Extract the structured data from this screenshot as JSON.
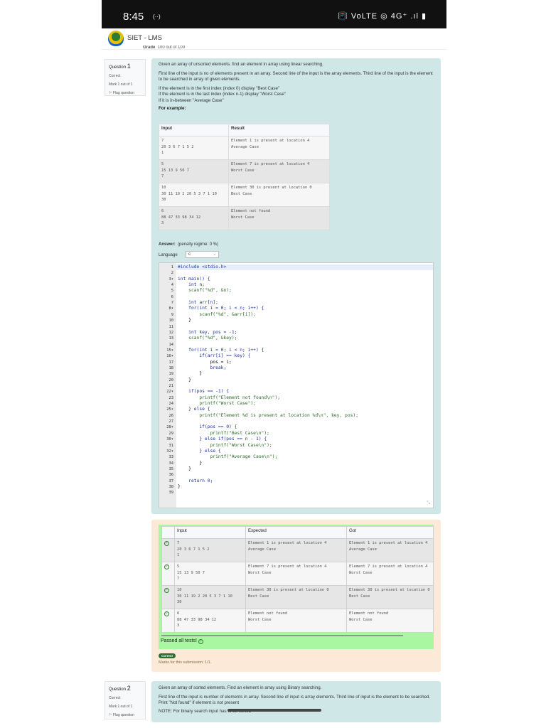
{
  "status_bar": {
    "time": "8:45",
    "left_icon": "hotspot-icon",
    "right": "📳 VoLTE ◎ 4G⁺ .ıl ▮"
  },
  "header": {
    "brand": "SIET - LMS",
    "grade_label": "Grade",
    "grade_value": "100 out of 100"
  },
  "q1": {
    "info": {
      "label": "Question",
      "number": "1",
      "state": "Correct",
      "mark": "Mark 1 out of 1",
      "flag": "Flag question"
    },
    "text": [
      "Given an array of unsorted elements. find an element in array using linear searching.",
      "First line of the input is no of elements present in an array. Second line of the input is the array elements. Third line of the input is the element to be searched in array of given elements.",
      "If the element is in the first index (index 0) display \"Best Case\"",
      "If the element is in the last index (index n-1) display \"Worst Case\"",
      "If it is in-between \"Average Case\""
    ],
    "for_example": "For example:",
    "example_headers": [
      "Input",
      "Result"
    ],
    "examples": [
      {
        "input": "7\n20 3 6 7 1 5 2\n1",
        "result": "Element 1 is present at location 4\nAverage Case"
      },
      {
        "input": "5\n15 13 9 50 7\n7",
        "result": "Element 7 is present at location 4\nWorst Case"
      },
      {
        "input": "10\n30 11 19 2 20 5 3 7 1 10\n30",
        "result": "Element 30 is present at location 0\nBest Case"
      },
      {
        "input": "6\n88 47 33 98 34 12\n3",
        "result": "Element not found\nWorst Case"
      }
    ],
    "answer_label": "Answer:",
    "penalty": "(penalty regime: 0 %)",
    "language_label": "Language",
    "language_value": "c",
    "code": [
      "#include <stdio.h>",
      "",
      "int main() {",
      "    int n;",
      "    scanf(\"%d\", &n);",
      "",
      "    int arr[n];",
      "    for(int i = 0; i < n; i++) {",
      "        scanf(\"%d\", &arr[i]);",
      "    }",
      "",
      "    int key, pos = -1;",
      "    scanf(\"%d\", &key);",
      "",
      "    for(int i = 0; i < n; i++) {",
      "        if(arr[i] == key) {",
      "            pos = i;",
      "            break;",
      "        }",
      "    }",
      "",
      "    if(pos == -1) {",
      "        printf(\"Element not found\\n\");",
      "        printf(\"Worst Case\");",
      "    } else {",
      "        printf(\"Element %d is present at location %d\\n\", key, pos);",
      "",
      "        if(pos == 0) {",
      "            printf(\"Best Case\\n\");",
      "        } else if(pos == n - 1) {",
      "            printf(\"Worst Case\\n\");",
      "        } else {",
      "            printf(\"Average Case\\n\");",
      "        }",
      "    }",
      "",
      "    return 0;",
      "}",
      ""
    ],
    "fold_lines": [
      3,
      8,
      15,
      16,
      22,
      25,
      28,
      30,
      32
    ],
    "result_headers": [
      "",
      "Input",
      "Expected",
      "Got"
    ],
    "results": [
      {
        "input": "7\n20 3 6 7 1 5 2\n1",
        "expected": "Element 1 is present at location 4\nAverage Case",
        "got": "Element 1 is present at location 4\nAverage Case"
      },
      {
        "input": "5\n15 13 9 50 7\n7",
        "expected": "Element 7 is present at location 4\nWorst Case",
        "got": "Element 7 is present at location 4\nWorst Case"
      },
      {
        "input": "10\n30 11 19 2 20 5 3 7 1 10\n30",
        "expected": "Element 30 is present at location 0\nBest Case",
        "got": "Element 30 is present at location 0\nBest Case"
      },
      {
        "input": "6\n88 47 33 98 34 12\n3",
        "expected": "Element not found\nWorst Case",
        "got": "Element not found\nWorst Case"
      }
    ],
    "passed": "Passed all tests!",
    "badge": "Correct",
    "marks": "Marks for this submission: 1/1."
  },
  "q2": {
    "info": {
      "label": "Question",
      "number": "2",
      "state": "Correct",
      "mark": "Mark 1 out of 1",
      "flag": "Flag question"
    },
    "text": [
      "Given an array of sorted elements. Find an element in array using Binary searching.",
      "First line of the input is number of elements in array. Second line of input is array elements. Third line of input is the element to be searched. Print \"Not found\" if element is not present",
      "NOTE: For binary search input has to be sorted"
    ]
  },
  "colors": {
    "question_bg": "#d0e7e7",
    "feedback_bg": "#fde9d7",
    "passed_bg": "#a9f7a0",
    "badge": "#2e6b2e"
  }
}
